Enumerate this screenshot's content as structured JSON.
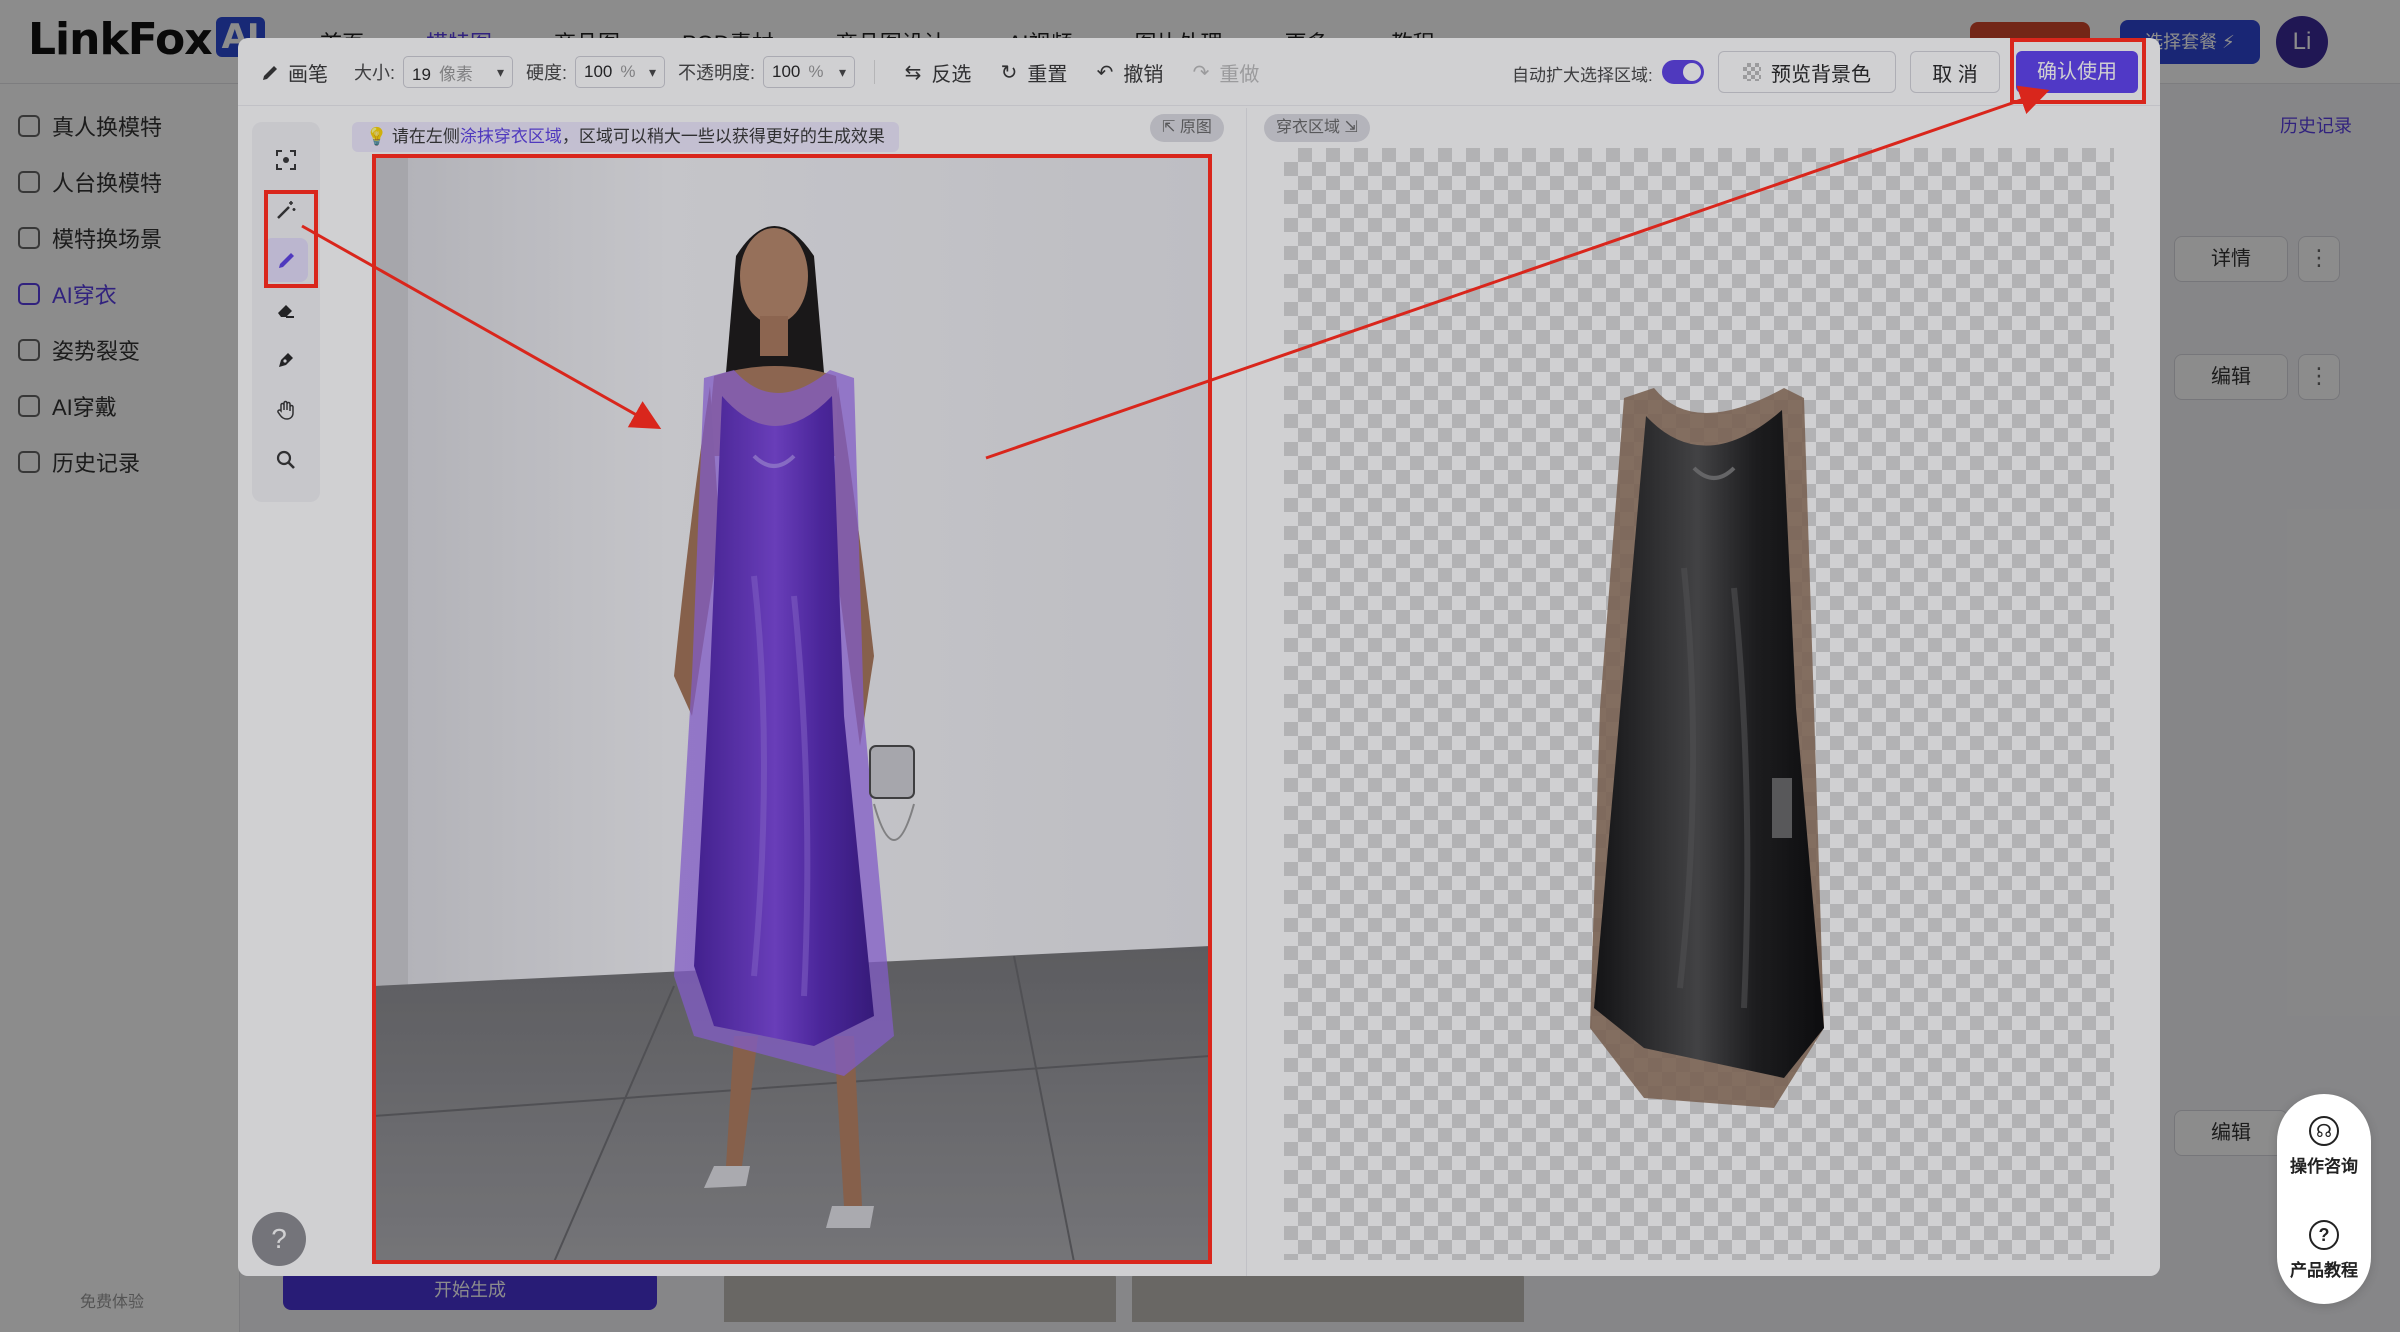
{
  "app": {
    "logo": "LinkFox",
    "logo_badge": "AI",
    "nav": [
      "首页",
      "模特图",
      "商品图",
      "POD素材",
      "商品图设计",
      "AI视频",
      "图片处理",
      "更多",
      "教程"
    ],
    "nav_package": "选择套餐 ⚡",
    "avatar": "Li",
    "sidebar": [
      "真人换模特",
      "人台换模特",
      "模特换场景",
      "AI穿衣",
      "姿势裂变",
      "AI穿戴",
      "历史记录"
    ],
    "sidebar_active": "AI穿衣",
    "sidebar_footer": "免费体验",
    "generate_button": "开始生成",
    "history_link": "历史记录",
    "detail_button": "详情",
    "edit_button": "编辑",
    "more_dots": "⋮",
    "help_float": {
      "consult": "操作咨询",
      "tutorial": "产品教程"
    }
  },
  "modal": {
    "toolbar": {
      "tool_name": "画笔",
      "size_label": "大小:",
      "size_value": "19",
      "size_unit": "像素",
      "hardness_label": "硬度:",
      "hardness_value": "100",
      "hardness_unit": "%",
      "opacity_label": "不透明度:",
      "opacity_value": "100",
      "opacity_unit": "%",
      "invert": "反选",
      "reset": "重置",
      "undo": "撤销",
      "redo": "重做",
      "auto_expand_label": "自动扩大选择区域:",
      "auto_expand_on": true,
      "preview_bg": "预览背景色",
      "cancel": "取 消",
      "confirm": "确认使用"
    },
    "tools": [
      "smart-select-icon",
      "magic-wand-icon",
      "brush-icon",
      "eraser-icon",
      "pen-icon",
      "hand-icon",
      "zoom-icon"
    ],
    "active_tool": "brush-icon",
    "hint_prefix": "请在左侧",
    "hint_emphasis": "涂抹穿衣区域",
    "hint_suffix": "，区域可以稍大一些以获得更好的生成效果",
    "left_pane_tag": "原图",
    "right_pane_tag": "穿衣区域",
    "help": "?",
    "mask_color": "#7a3fe0",
    "accent": "#5b3ef0",
    "highlight_color": "#d9261c"
  }
}
